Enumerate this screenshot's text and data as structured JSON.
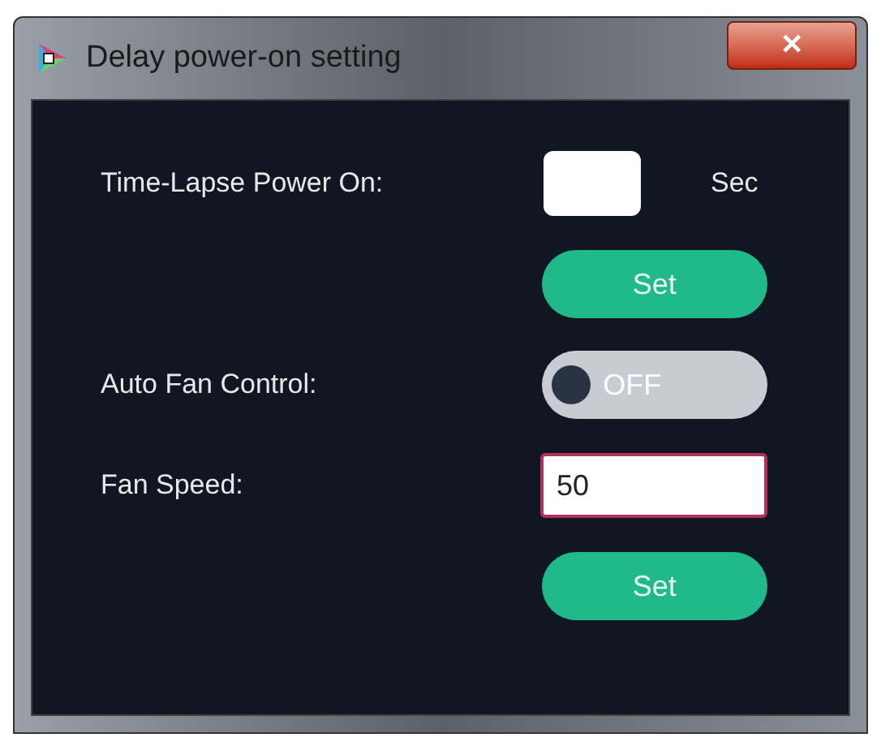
{
  "window": {
    "title": "Delay power-on setting",
    "close": "✕"
  },
  "rows": [
    {
      "kind": "field",
      "label": "Time-Lapse Power On:",
      "value": "",
      "unit": "Sec",
      "focused": false
    },
    {
      "kind": "button",
      "label": "Set"
    },
    {
      "kind": "toggle",
      "label": "Auto Fan Control:",
      "on": false,
      "state_text": "OFF"
    },
    {
      "kind": "field",
      "label": "Fan Speed:",
      "value": "50",
      "focused": true
    },
    {
      "kind": "button",
      "label": "Set"
    }
  ]
}
